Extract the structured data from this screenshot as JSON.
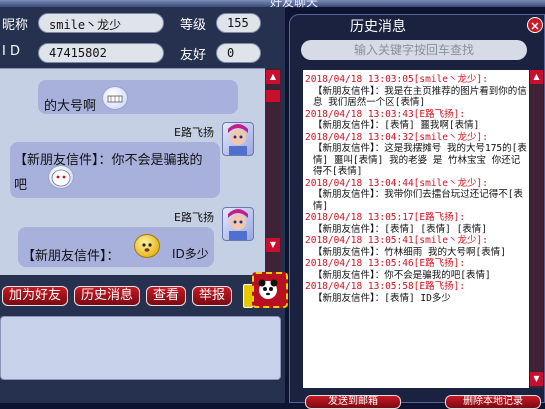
{
  "window": {
    "title": "好友聊天"
  },
  "profile": {
    "nick_label": "昵称",
    "nick_value": "smile丶龙少",
    "level_label": "等级",
    "level_value": "155",
    "id_label": "I D",
    "id_value": "47415802",
    "friend_label": "友好",
    "friend_value": "0"
  },
  "chat": {
    "messages": [
      {
        "text": "的大号啊"
      },
      {
        "sender": "E路飞扬",
        "text": "【新朋友信件】：你不会是骗我的吧"
      },
      {
        "sender": "E路飞扬",
        "text": "【新朋友信件】：",
        "tail": "ID多少"
      }
    ]
  },
  "actions": {
    "add_friend": "加为好友",
    "history": "历史消息",
    "view": "查看",
    "report": "举报"
  },
  "history": {
    "title": "历史消息",
    "search_placeholder": "输入关键字按回车查找",
    "entries": [
      {
        "time": "2018/04/18 13:03:05",
        "user": "[smile丶龙少]:",
        "text": "【新朋友信件】：我是在主页推荐的图片看到你的信息 我们居然一个区[表情]"
      },
      {
        "time": "2018/04/18 13:03:43",
        "user": "[E路飞扬]:",
        "text": "【新朋友信件】：[表情] 噩我啊[表情]"
      },
      {
        "time": "2018/04/18 13:04:32",
        "user": "[smile丶龙少]:",
        "text": "【新朋友信件】：这是我摆摊号 我的大号175的[表情] 噩叫[表情] 我的老婆 是 竹林宝宝 你还记得不[表情]"
      },
      {
        "time": "2018/04/18 13:04:44",
        "user": "[smile丶龙少]:",
        "text": "【新朋友信件】：我带你们去擂台玩过还记得不[表情]"
      },
      {
        "time": "2018/04/18 13:05:17",
        "user": "[E路飞扬]:",
        "text": "【新朋友信件】：[表情] [表情] [表情]"
      },
      {
        "time": "2018/04/18 13:05:41",
        "user": "[smile丶龙少]:",
        "text": "【新朋友信件】：竹林细雨 我的大号啊[表情]"
      },
      {
        "time": "2018/04/18 13:05:46",
        "user": "[E路飞扬]:",
        "text": "【新朋友信件】：你不会是骗我的吧[表情]"
      },
      {
        "time": "2018/04/18 13:05:58",
        "user": "[E路飞扬]:",
        "text": "【新朋友信件】：[表情] ID多少"
      }
    ],
    "send_msg": "发送到邮箱",
    "delete_all": "删除本地记录"
  },
  "colors": {
    "accent_red": "#c81a24",
    "timestamp_red": "#d4101c"
  }
}
